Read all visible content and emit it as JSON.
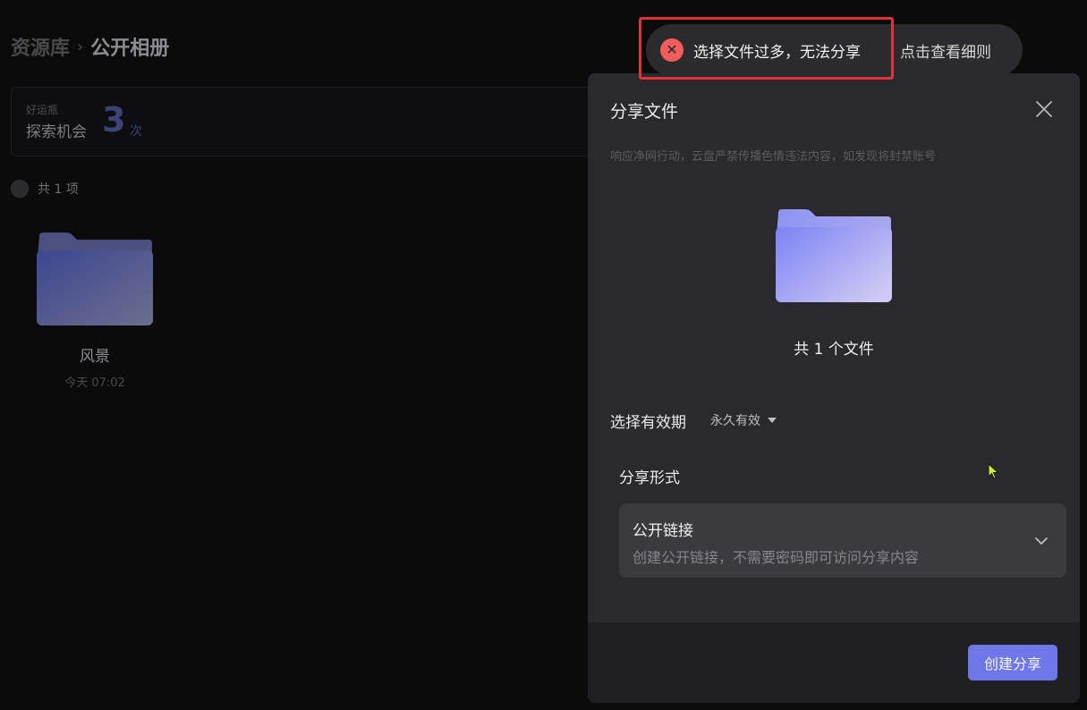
{
  "breadcrumb": {
    "root": "资源库",
    "separator": "›",
    "current": "公开相册"
  },
  "lucky": {
    "label_small": "好运瓶",
    "label": "探索机会",
    "count": "3",
    "unit": "次"
  },
  "list": {
    "select_all_label": "共 1 项"
  },
  "folder": {
    "name": "风景",
    "date": "今天 07:02"
  },
  "toast": {
    "icon": "error-circle-icon",
    "message": "选择文件过多，无法分享",
    "link_label": "点击查看细则"
  },
  "dialog": {
    "title": "分享文件",
    "notice": "响应净网行动，云盘严禁传播色情违法内容，如发现将封禁账号",
    "file_count": "共 1 个文件",
    "validity_label": "选择有效期",
    "validity_value": "永久有效",
    "share_form_label": "分享形式",
    "share_option": {
      "title": "公开链接",
      "description": "创建公开链接，不需要密码即可访问分享内容"
    },
    "create_button": "创建分享"
  },
  "colors": {
    "accent": "#6e76e8",
    "error": "#f25c5c",
    "highlight_outline": "#e0343b"
  }
}
